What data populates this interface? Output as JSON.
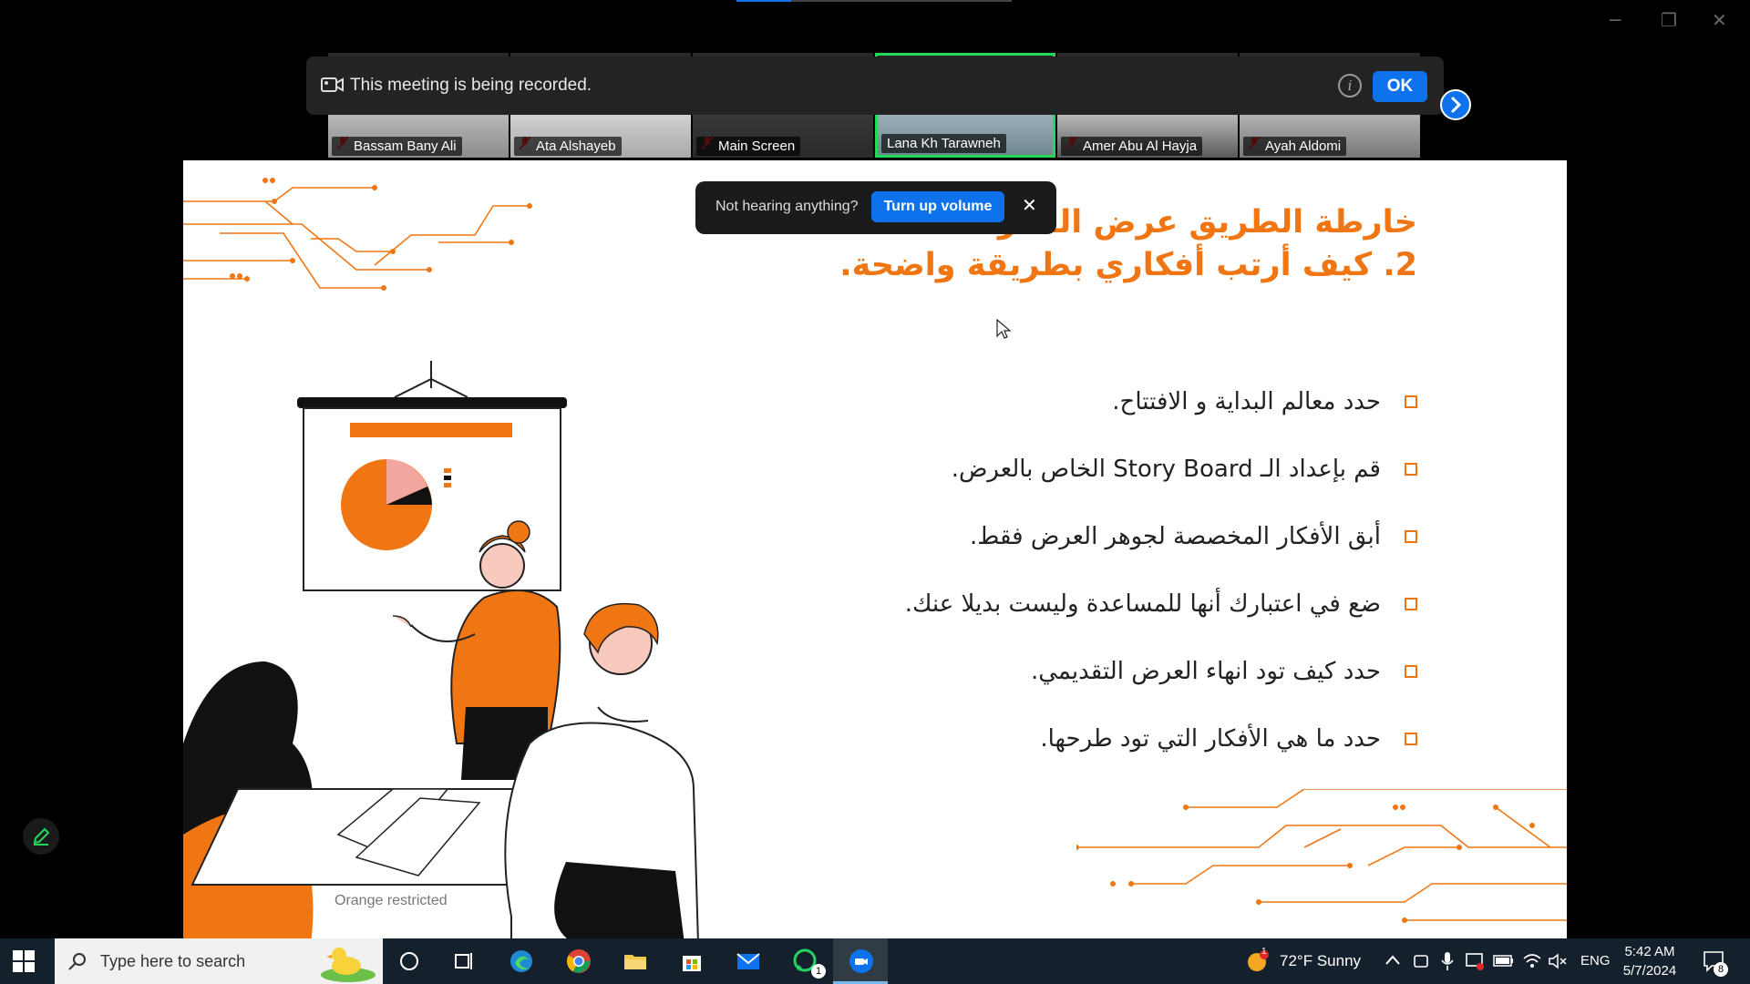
{
  "window": {
    "minimize": "─",
    "restore": "❐",
    "close": "✕"
  },
  "participants": [
    {
      "name": "Bassam Bany Ali",
      "active": false
    },
    {
      "name": "Ata Alshayeb",
      "active": false
    },
    {
      "name": "Main Screen",
      "active": false
    },
    {
      "name": "Lana Kh Tarawneh",
      "active": true
    },
    {
      "name": "Amer Abu Al Hayja",
      "active": false
    },
    {
      "name": "Ayah Aldomi",
      "active": false
    }
  ],
  "recording": {
    "text": "This meeting is being recorded.",
    "info": "i",
    "ok_label": "OK"
  },
  "audio_prompt": {
    "text": "Not hearing anything?",
    "button": "Turn up volume",
    "close": "✕"
  },
  "slide": {
    "title1": "خارطة الطريق عرض الفكرة",
    "title2": "2. كيف أرتب أفكاري بطريقة واضحة.",
    "bullets": [
      "حدد معالم البداية و الافتتاح.",
      "قم بإعداد الـ   Story Board  الخاص بالعرض.",
      "أبق الأفكار المخصصة لجوهر العرض فقط.",
      "ضع في اعتبارك أنها للمساعدة وليست بديلا عنك.",
      "حدد كيف تود انهاء العرض التقديمي.",
      "حدد ما هي الأفكار التي تود طرحها."
    ],
    "footer": "Orange restricted",
    "accent": "#f07613"
  },
  "taskbar": {
    "search_placeholder": "Type here to search",
    "weather": "72°F  Sunny",
    "language": "ENG",
    "time": "5:42 AM",
    "date": "5/7/2024",
    "whatsapp_badge": "1",
    "notification_count": "8",
    "weather_badge": "1"
  }
}
